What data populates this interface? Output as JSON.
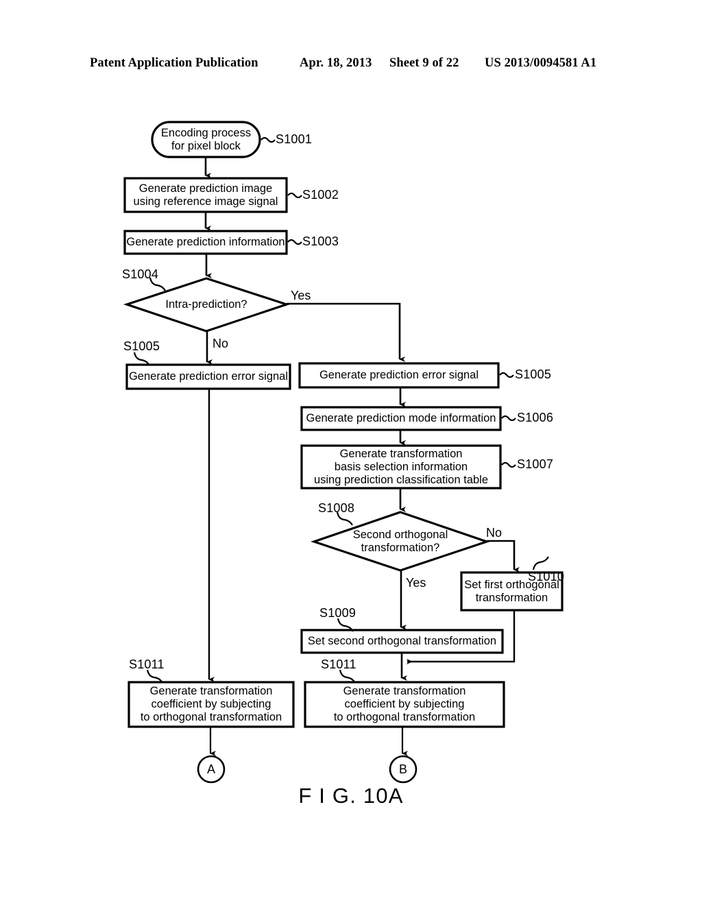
{
  "header": {
    "publication": "Patent Application Publication",
    "date": "Apr. 18, 2013",
    "sheet": "Sheet 9 of 22",
    "number": "US 2013/0094581 A1"
  },
  "figure": {
    "caption": "F I G. 10A"
  },
  "colors": {
    "ink": "#000000",
    "paper": "#ffffff"
  },
  "flowchart": {
    "nodes": {
      "start": {
        "text": "Encoding process\nfor pixel block",
        "step": "S1001",
        "shape": "terminator"
      },
      "s1002": {
        "text": "Generate prediction image\nusing reference image signal",
        "step": "S1002",
        "shape": "process"
      },
      "s1003": {
        "text": "Generate prediction information",
        "step": "S1003",
        "shape": "process"
      },
      "s1004": {
        "text": "Intra-prediction?",
        "step": "S1004",
        "shape": "decision"
      },
      "s1005_left": {
        "text": "Generate prediction error signal",
        "step": "S1005",
        "shape": "process"
      },
      "s1005_right": {
        "text": "Generate prediction error signal",
        "step": "S1005",
        "shape": "process"
      },
      "s1006": {
        "text": "Generate prediction mode information",
        "step": "S1006",
        "shape": "process"
      },
      "s1007": {
        "text": "Generate transformation\nbasis selection information\nusing prediction classification table",
        "step": "S1007",
        "shape": "process"
      },
      "s1008": {
        "text": "Second orthogonal\ntransformation?",
        "step": "S1008",
        "shape": "decision"
      },
      "s1009": {
        "text": "Set second orthogonal transformation",
        "step": "S1009",
        "shape": "process"
      },
      "s1010": {
        "text": "Set first orthogonal\ntransformation",
        "step": "S1010",
        "shape": "process"
      },
      "s1011_left": {
        "text": "Generate transformation\ncoefficient by subjecting\nto orthogonal transformation",
        "step": "S1011",
        "shape": "process"
      },
      "s1011_right": {
        "text": "Generate transformation\ncoefficient by subjecting\nto orthogonal transformation",
        "step": "S1011",
        "shape": "process"
      },
      "connector_a": {
        "text": "A",
        "shape": "connector"
      },
      "connector_b": {
        "text": "B",
        "shape": "connector"
      }
    },
    "branch_labels": {
      "s1004_yes": "Yes",
      "s1004_no": "No",
      "s1008_no": "No",
      "s1008_yes": "Yes"
    }
  }
}
